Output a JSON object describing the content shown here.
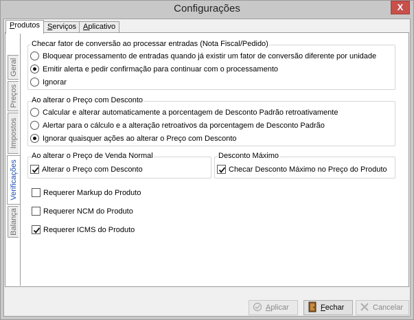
{
  "window": {
    "title": "Configurações",
    "close_label": "X"
  },
  "top_tabs": [
    {
      "label": "Produtos",
      "underline_char": "P",
      "rest": "rodutos",
      "active": true
    },
    {
      "label": "Serviços",
      "underline_char": "S",
      "rest": "erviços",
      "active": false
    },
    {
      "label": "Aplicativo",
      "underline_char": "A",
      "rest": "plicativo",
      "active": false
    }
  ],
  "side_tabs": [
    {
      "label": "Geral",
      "active": false
    },
    {
      "label": "Preços",
      "active": false
    },
    {
      "label": "Impostos",
      "active": false
    },
    {
      "label": "Verificações",
      "active": true
    },
    {
      "label": "Balança",
      "active": false
    }
  ],
  "group_conversion": {
    "title": "Checar fator de conversão ao processar entradas (Nota Fiscal/Pedido)",
    "options": [
      {
        "label": "Bloquear processamento de entradas quando já existir um fator de conversão diferente por unidade",
        "selected": false
      },
      {
        "label": "Emitir alerta e pedir confirmação para continuar com o processamento",
        "selected": true
      },
      {
        "label": "Ignorar",
        "selected": false
      }
    ]
  },
  "group_discount_price": {
    "title": "Ao alterar o Preço com Desconto",
    "options": [
      {
        "label": "Calcular e alterar automaticamente a porcentagem de Desconto Padrão retroativamente",
        "selected": false
      },
      {
        "label": "Alertar para o cálculo e a alteração retroativos da porcentagem de Desconto Padrão",
        "selected": false
      },
      {
        "label": "Ignorar quaisquer ações ao alterar o Preço com Desconto",
        "selected": true
      }
    ]
  },
  "group_normal_price": {
    "title": "Ao alterar o Preço de Venda Normal",
    "checkbox": {
      "label": "Alterar o Preço com Desconto",
      "checked": true
    }
  },
  "group_max_discount": {
    "title": "Desconto Máximo",
    "checkbox": {
      "label": "Checar Desconto Máximo no Preço do Produto",
      "checked": true
    }
  },
  "checks": [
    {
      "label": "Requerer Markup do Produto",
      "checked": false
    },
    {
      "label": "Requerer NCM do Produto",
      "checked": false
    },
    {
      "label": "Requerer ICMS do Produto",
      "checked": true
    }
  ],
  "buttons": {
    "apply": {
      "underline_char": "A",
      "rest": "plicar",
      "disabled": true
    },
    "close": {
      "underline_char": "F",
      "rest": "echar",
      "disabled": false
    },
    "cancel": {
      "label": "Cancelar",
      "disabled": true
    }
  },
  "colors": {
    "title_bg": "#c8c8c8",
    "close_btn": "#c7504b",
    "active_side_tab_text": "#1e4fb5"
  }
}
